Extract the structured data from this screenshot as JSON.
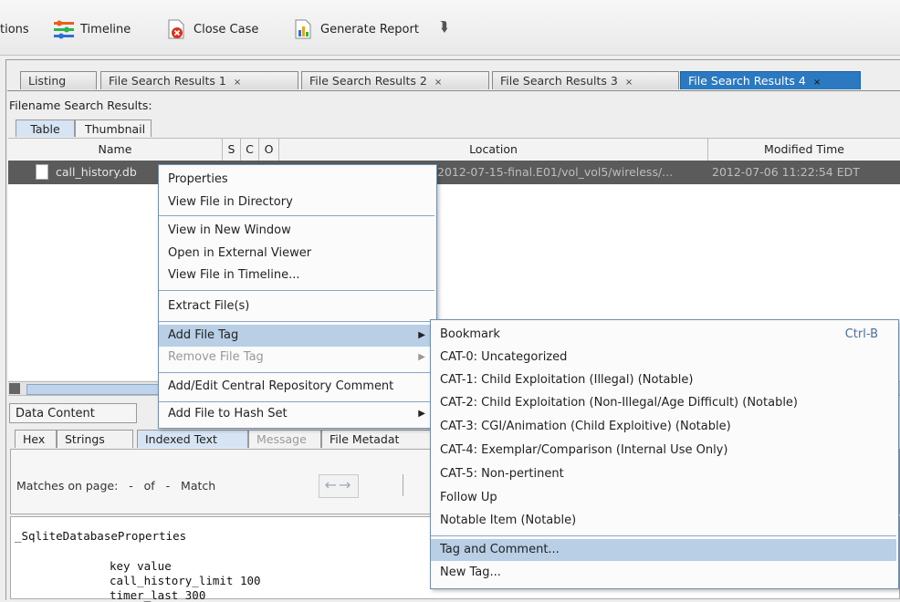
{
  "toolbar": {
    "partial_label": "tions",
    "timeline": "Timeline",
    "close_case": "Close Case",
    "generate_report": "Generate Report",
    "more": "»"
  },
  "tabs": [
    {
      "label": "Listing"
    },
    {
      "label": "File Search Results 1",
      "close": "×"
    },
    {
      "label": "File Search Results 2",
      "close": "×"
    },
    {
      "label": "File Search Results 3",
      "close": "×"
    },
    {
      "label": "File Search Results 4",
      "close": "×"
    }
  ],
  "results": {
    "label": "Filename Search Results:",
    "view_tabs": [
      "Table",
      "Thumbnail"
    ],
    "columns": [
      "Name",
      "S",
      "C",
      "O",
      "Location",
      "Modified Time"
    ],
    "rows": [
      {
        "name": "call_history.db",
        "location": "2012-07-15-final.E01/vol_vol5/wireless/...",
        "modified": "2012-07-06 11:22:54 EDT"
      }
    ]
  },
  "lower": {
    "data_content": "Data Content",
    "tabs": [
      "Hex",
      "Strings",
      "Indexed Text",
      "Message",
      "File Metadat"
    ],
    "matches_label": "Matches on page:   -   of   -   Match",
    "text_lines": [
      "_SqliteDatabaseProperties",
      "key value",
      "call_history_limit 100",
      "timer_last 300"
    ]
  },
  "context_menu": {
    "items": [
      "Properties",
      "View File in Directory",
      "View in New Window",
      "Open in External Viewer",
      "View File in Timeline...",
      "Extract File(s)",
      "Add File Tag",
      "Remove File Tag",
      "Add/Edit Central Repository Comment",
      "Add File to Hash Set"
    ]
  },
  "submenu": {
    "items": [
      {
        "label": "Bookmark",
        "shortcut": "Ctrl-B"
      },
      {
        "label": "CAT-0: Uncategorized"
      },
      {
        "label": "CAT-1: Child Exploitation (Illegal) (Notable)"
      },
      {
        "label": "CAT-2: Child Exploitation (Non-Illegal/Age Difficult) (Notable)"
      },
      {
        "label": "CAT-3: CGI/Animation (Child Exploitive) (Notable)"
      },
      {
        "label": "CAT-4: Exemplar/Comparison (Internal Use Only)"
      },
      {
        "label": "CAT-5: Non-pertinent"
      },
      {
        "label": "Follow Up"
      },
      {
        "label": "Notable Item (Notable)"
      },
      {
        "label": "Tag and Comment..."
      },
      {
        "label": "New Tag..."
      }
    ]
  }
}
